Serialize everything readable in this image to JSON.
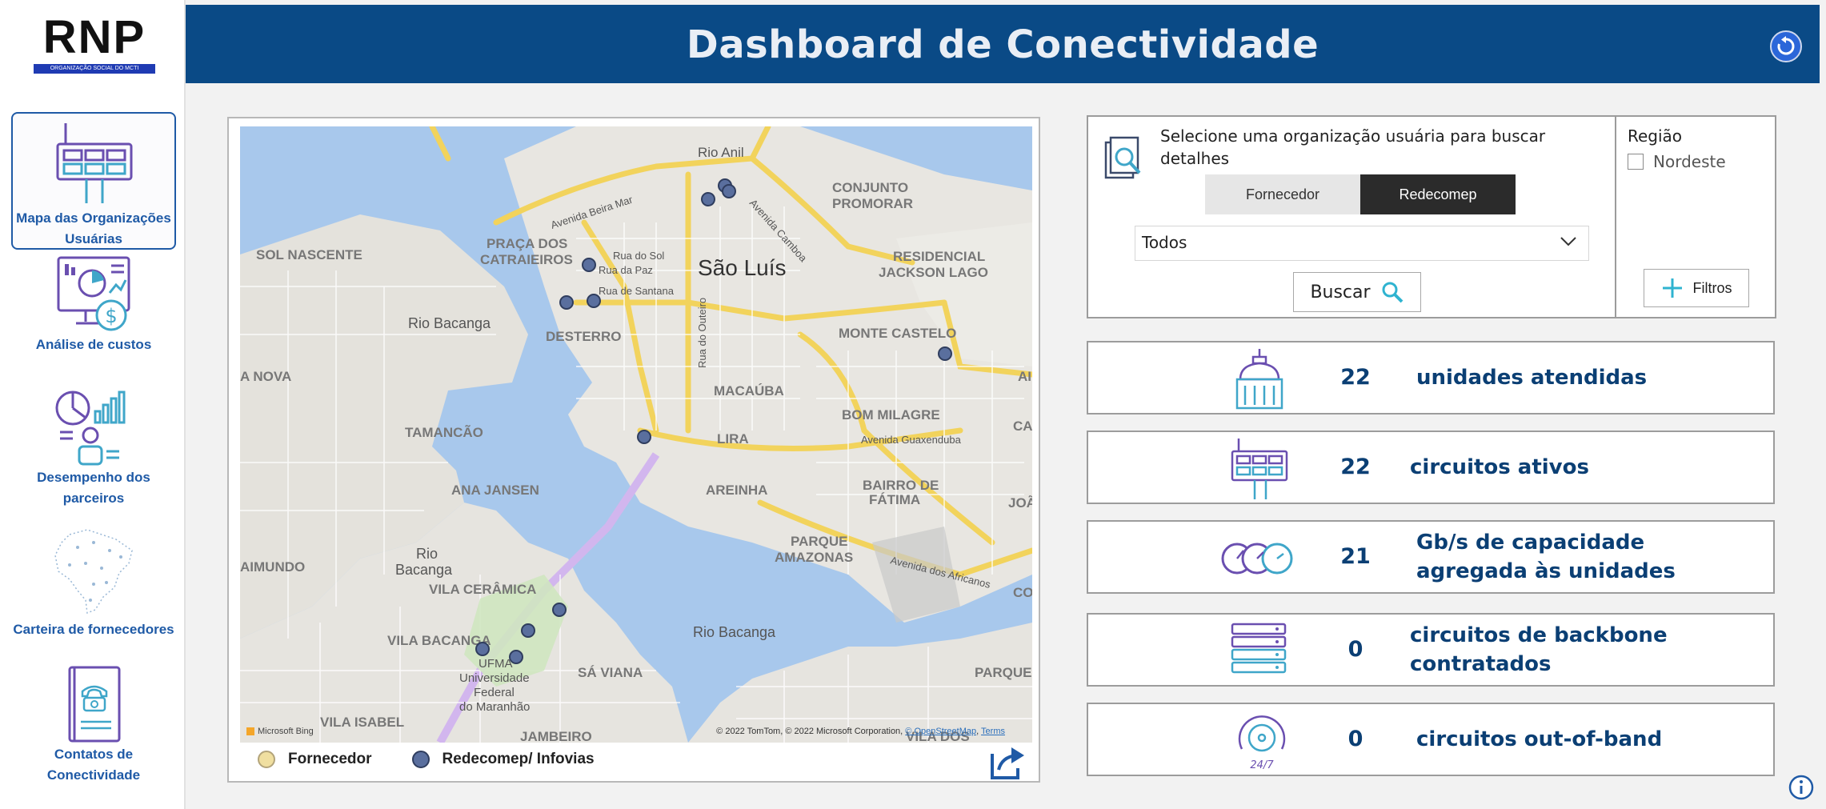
{
  "header": {
    "title": "Dashboard de Conectividade",
    "reset_icon": "reset-icon"
  },
  "logo": {
    "text": "RNP",
    "subtitle": "ORGANIZAÇÃO SOCIAL DO MCTI"
  },
  "sidebar": {
    "items": [
      {
        "label": "Mapa das Organizações Usuárias",
        "icon": "network-icon",
        "active": true
      },
      {
        "label": "Análise de custos",
        "icon": "cost-dashboard-icon",
        "active": false
      },
      {
        "label": "Desempenho dos parceiros",
        "icon": "partner-performance-icon",
        "active": false
      },
      {
        "label": "Carteira de fornecedores",
        "icon": "brazil-map-icon",
        "active": false
      },
      {
        "label": "Contatos de Conectividade",
        "icon": "phone-book-icon",
        "active": false
      }
    ]
  },
  "map": {
    "labels": {
      "rio_anil": "Rio Anil",
      "conjunto": "CONJUNTO",
      "promorar": "PROMORAR",
      "sol_nascente": "SOL NASCENTE",
      "praca_dos": "PRAÇA DOS",
      "catraieiros": "CATRAIEIROS",
      "rua_do_sol": "Rua do Sol",
      "rua_da_paz": "Rua da Paz",
      "rua_de_santana": "Rua de Santana",
      "sao_luis": "São Luís",
      "residencial": "RESIDENCIAL",
      "jackson_lago": "JACKSON LAGO",
      "rio_bacanga_1": "Rio Bacanga",
      "desterro": "DESTERRO",
      "monte_castelo": "MONTE CASTELO",
      "a_nova": "A NOVA",
      "macauba": "MACAÚBA",
      "bom_milagre": "BOM MILAGRE",
      "tamancao": "TAMANCÃO",
      "lira": "LIRA",
      "avenida_guaxenduba": "Avenida Guaxenduba",
      "ana_jansen": "ANA JANSEN",
      "areinha": "AREINHA",
      "bairro_de": "BAIRRO DE",
      "fatima": "FÁTIMA",
      "joao": "JOÃO",
      "rio_bacanga_2a": "Rio",
      "rio_bacanga_2b": "Bacanga",
      "aimundo": "AIMUNDO",
      "vila_ceramica": "VILA CERÂMICA",
      "parque": "PARQUE",
      "amazonas": "AMAZONAS",
      "avenida_africanos": "Avenida dos Africanos",
      "rio_bacanga_3": "Rio Bacanga",
      "vila_bacanga": "VILA BACANGA",
      "sa_viana": "SÁ VIANA",
      "ufma_1": "UFMA",
      "ufma_2": "Universidade",
      "ufma_3": "Federal",
      "ufma_4": "do Maranhão",
      "parque_r": "PARQUE",
      "vila_isabel": "VILA ISABEL",
      "jambeiro": "JAMBEIRO",
      "avenida_camboa": "Avenida Camboa",
      "avenida_beira_mar": "Avenida Beira Mar",
      "rua_do_outeiro": "Rua do Outeiro",
      "vila_dos": "VILA DOS",
      "co": "CO",
      "ca": "CA",
      "ai": "AI"
    },
    "attribution": "Microsoft Bing",
    "copyright": "© 2022 TomTom, © 2022 Microsoft Corporation,",
    "osm_link": "© OpenStreetMap",
    "terms_link": "Terms",
    "points_color": "#5a6f9e"
  },
  "legend": {
    "items": [
      {
        "label": "Fornecedor",
        "color": "#f0dfa0"
      },
      {
        "label": "Redecomep/ Infovias",
        "color": "#5a6f9e"
      }
    ]
  },
  "org_search": {
    "prompt": "Selecione uma organização usuária para buscar detalhes",
    "toggle": [
      {
        "label": "Fornecedor",
        "selected": false
      },
      {
        "label": "Redecomep",
        "selected": true
      }
    ],
    "select_value": "Todos",
    "search_button": "Buscar"
  },
  "region": {
    "title": "Região",
    "options": [
      {
        "label": "Nordeste",
        "checked": false
      }
    ],
    "filter_button": "Filtros"
  },
  "kpis": [
    {
      "icon": "building-icon",
      "value": "22",
      "label": "unidades atendidas"
    },
    {
      "icon": "circuit-icon",
      "value": "22",
      "label": "circuitos ativos"
    },
    {
      "icon": "gauge-icon",
      "value": "21",
      "label": "Gb/s de capacidade agregada às unidades"
    },
    {
      "icon": "server-icon",
      "value": "0",
      "label": "circuitos de backbone contratados"
    },
    {
      "icon": "24-7-icon",
      "value": "0",
      "label": "circuitos out-of-band"
    }
  ],
  "colors": {
    "header": "#0a4a86",
    "accent": "#1f5aa6",
    "kpi_text": "#0b3f74"
  }
}
